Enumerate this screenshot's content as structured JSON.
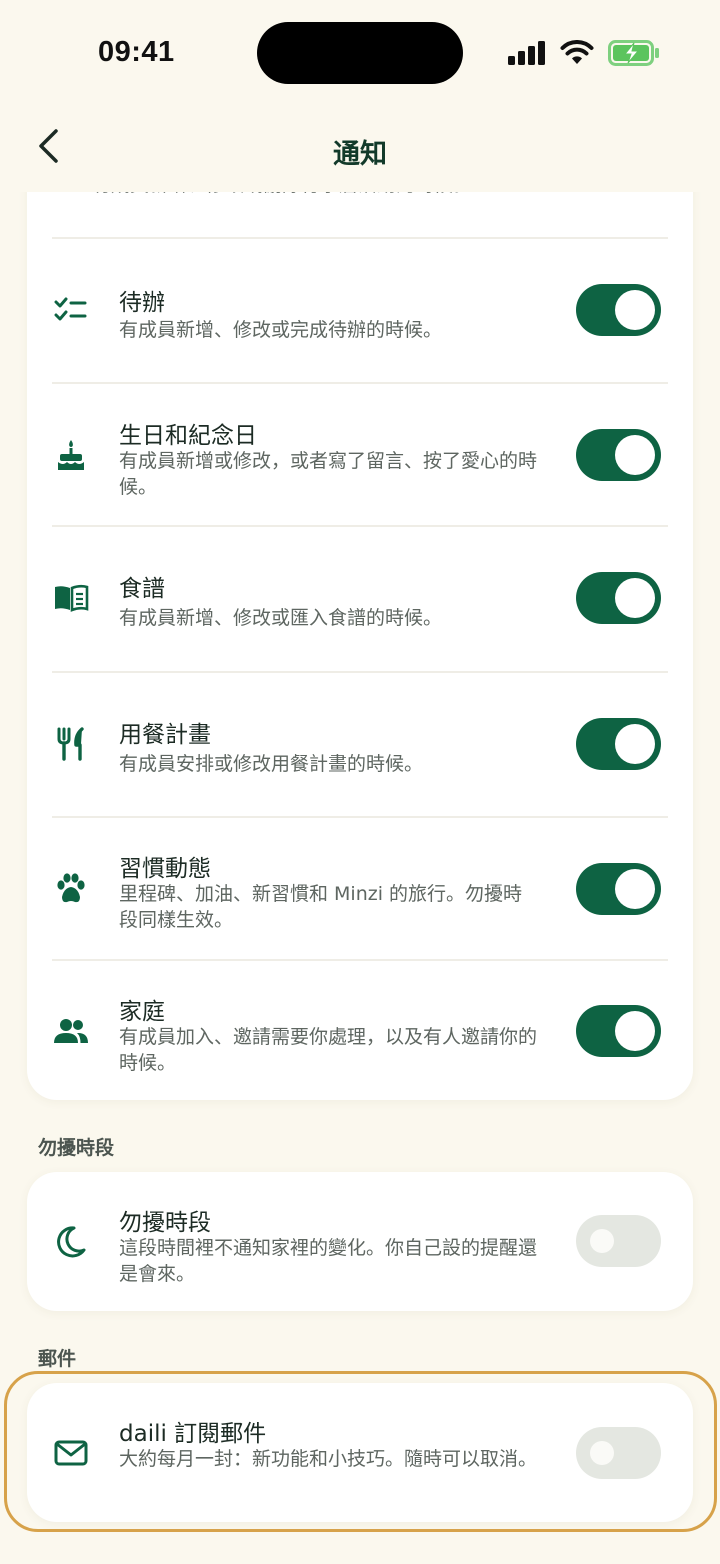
{
  "status": {
    "time": "09:41"
  },
  "header": {
    "title": "通知"
  },
  "partial_text": "有成員新增、修改或刪除行事曆活動的時候。",
  "rows": [
    {
      "title": "待辦",
      "desc": "有成員新增、修改或完成待辦的時候。",
      "on": true,
      "icon": "checklist-icon"
    },
    {
      "title": "生日和紀念日",
      "desc": "有成員新增或修改，或者寫了留言、按了愛心的時候。",
      "on": true,
      "icon": "cake-icon"
    },
    {
      "title": "食譜",
      "desc": "有成員新增、修改或匯入食譜的時候。",
      "on": true,
      "icon": "recipe-book-icon"
    },
    {
      "title": "用餐計畫",
      "desc": "有成員安排或修改用餐計畫的時候。",
      "on": true,
      "icon": "fork-knife-icon"
    },
    {
      "title": "習慣動態",
      "desc": "里程碑、加油、新習慣和 Minzi 的旅行。勿擾時段同樣生效。",
      "on": true,
      "icon": "paw-icon"
    },
    {
      "title": "家庭",
      "desc": "有成員加入、邀請需要你處理，以及有人邀請你的時候。",
      "on": true,
      "icon": "people-icon"
    }
  ],
  "dnd_section": {
    "label": "勿擾時段",
    "title": "勿擾時段",
    "desc": "這段時間裡不通知家裡的變化。你自己設的提醒還是會來。",
    "on": false,
    "icon": "moon-icon"
  },
  "mail_section": {
    "label": "郵件",
    "title": "daili 訂閱郵件",
    "desc": "大約每月一封：新功能和小技巧。隨時可以取消。",
    "on": false,
    "icon": "mail-icon"
  },
  "colors": {
    "accent": "#0E6343",
    "background": "#FBF8EE",
    "highlight": "#D7A24A",
    "toggle_off": "#E4E7E1"
  }
}
